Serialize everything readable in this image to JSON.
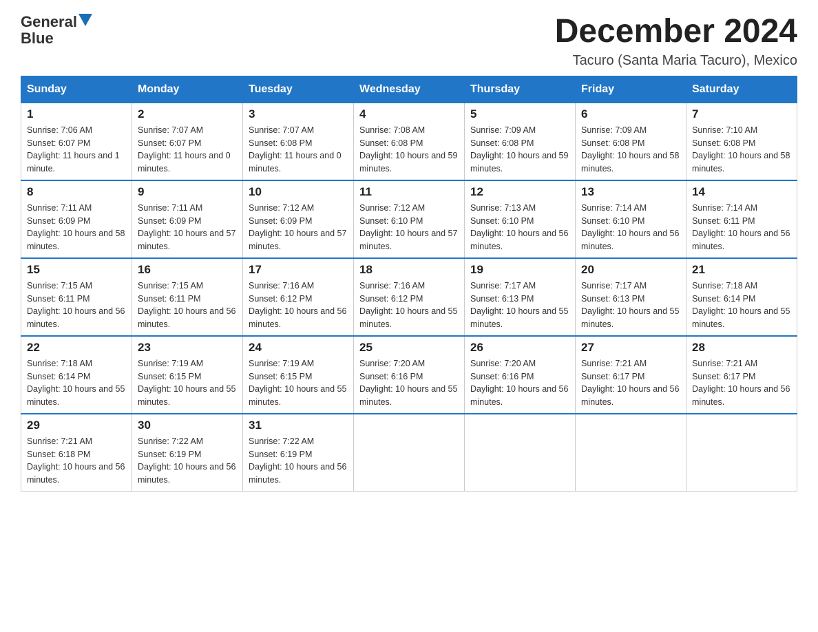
{
  "logo": {
    "text_general": "General",
    "text_blue": "Blue",
    "arrow": "▼"
  },
  "title": "December 2024",
  "location": "Tacuro (Santa Maria Tacuro), Mexico",
  "days_of_week": [
    "Sunday",
    "Monday",
    "Tuesday",
    "Wednesday",
    "Thursday",
    "Friday",
    "Saturday"
  ],
  "weeks": [
    [
      {
        "day": "1",
        "sunrise": "7:06 AM",
        "sunset": "6:07 PM",
        "daylight": "11 hours and 1 minute."
      },
      {
        "day": "2",
        "sunrise": "7:07 AM",
        "sunset": "6:07 PM",
        "daylight": "11 hours and 0 minutes."
      },
      {
        "day": "3",
        "sunrise": "7:07 AM",
        "sunset": "6:08 PM",
        "daylight": "11 hours and 0 minutes."
      },
      {
        "day": "4",
        "sunrise": "7:08 AM",
        "sunset": "6:08 PM",
        "daylight": "10 hours and 59 minutes."
      },
      {
        "day": "5",
        "sunrise": "7:09 AM",
        "sunset": "6:08 PM",
        "daylight": "10 hours and 59 minutes."
      },
      {
        "day": "6",
        "sunrise": "7:09 AM",
        "sunset": "6:08 PM",
        "daylight": "10 hours and 58 minutes."
      },
      {
        "day": "7",
        "sunrise": "7:10 AM",
        "sunset": "6:08 PM",
        "daylight": "10 hours and 58 minutes."
      }
    ],
    [
      {
        "day": "8",
        "sunrise": "7:11 AM",
        "sunset": "6:09 PM",
        "daylight": "10 hours and 58 minutes."
      },
      {
        "day": "9",
        "sunrise": "7:11 AM",
        "sunset": "6:09 PM",
        "daylight": "10 hours and 57 minutes."
      },
      {
        "day": "10",
        "sunrise": "7:12 AM",
        "sunset": "6:09 PM",
        "daylight": "10 hours and 57 minutes."
      },
      {
        "day": "11",
        "sunrise": "7:12 AM",
        "sunset": "6:10 PM",
        "daylight": "10 hours and 57 minutes."
      },
      {
        "day": "12",
        "sunrise": "7:13 AM",
        "sunset": "6:10 PM",
        "daylight": "10 hours and 56 minutes."
      },
      {
        "day": "13",
        "sunrise": "7:14 AM",
        "sunset": "6:10 PM",
        "daylight": "10 hours and 56 minutes."
      },
      {
        "day": "14",
        "sunrise": "7:14 AM",
        "sunset": "6:11 PM",
        "daylight": "10 hours and 56 minutes."
      }
    ],
    [
      {
        "day": "15",
        "sunrise": "7:15 AM",
        "sunset": "6:11 PM",
        "daylight": "10 hours and 56 minutes."
      },
      {
        "day": "16",
        "sunrise": "7:15 AM",
        "sunset": "6:11 PM",
        "daylight": "10 hours and 56 minutes."
      },
      {
        "day": "17",
        "sunrise": "7:16 AM",
        "sunset": "6:12 PM",
        "daylight": "10 hours and 56 minutes."
      },
      {
        "day": "18",
        "sunrise": "7:16 AM",
        "sunset": "6:12 PM",
        "daylight": "10 hours and 55 minutes."
      },
      {
        "day": "19",
        "sunrise": "7:17 AM",
        "sunset": "6:13 PM",
        "daylight": "10 hours and 55 minutes."
      },
      {
        "day": "20",
        "sunrise": "7:17 AM",
        "sunset": "6:13 PM",
        "daylight": "10 hours and 55 minutes."
      },
      {
        "day": "21",
        "sunrise": "7:18 AM",
        "sunset": "6:14 PM",
        "daylight": "10 hours and 55 minutes."
      }
    ],
    [
      {
        "day": "22",
        "sunrise": "7:18 AM",
        "sunset": "6:14 PM",
        "daylight": "10 hours and 55 minutes."
      },
      {
        "day": "23",
        "sunrise": "7:19 AM",
        "sunset": "6:15 PM",
        "daylight": "10 hours and 55 minutes."
      },
      {
        "day": "24",
        "sunrise": "7:19 AM",
        "sunset": "6:15 PM",
        "daylight": "10 hours and 55 minutes."
      },
      {
        "day": "25",
        "sunrise": "7:20 AM",
        "sunset": "6:16 PM",
        "daylight": "10 hours and 55 minutes."
      },
      {
        "day": "26",
        "sunrise": "7:20 AM",
        "sunset": "6:16 PM",
        "daylight": "10 hours and 56 minutes."
      },
      {
        "day": "27",
        "sunrise": "7:21 AM",
        "sunset": "6:17 PM",
        "daylight": "10 hours and 56 minutes."
      },
      {
        "day": "28",
        "sunrise": "7:21 AM",
        "sunset": "6:17 PM",
        "daylight": "10 hours and 56 minutes."
      }
    ],
    [
      {
        "day": "29",
        "sunrise": "7:21 AM",
        "sunset": "6:18 PM",
        "daylight": "10 hours and 56 minutes."
      },
      {
        "day": "30",
        "sunrise": "7:22 AM",
        "sunset": "6:19 PM",
        "daylight": "10 hours and 56 minutes."
      },
      {
        "day": "31",
        "sunrise": "7:22 AM",
        "sunset": "6:19 PM",
        "daylight": "10 hours and 56 minutes."
      },
      null,
      null,
      null,
      null
    ]
  ]
}
